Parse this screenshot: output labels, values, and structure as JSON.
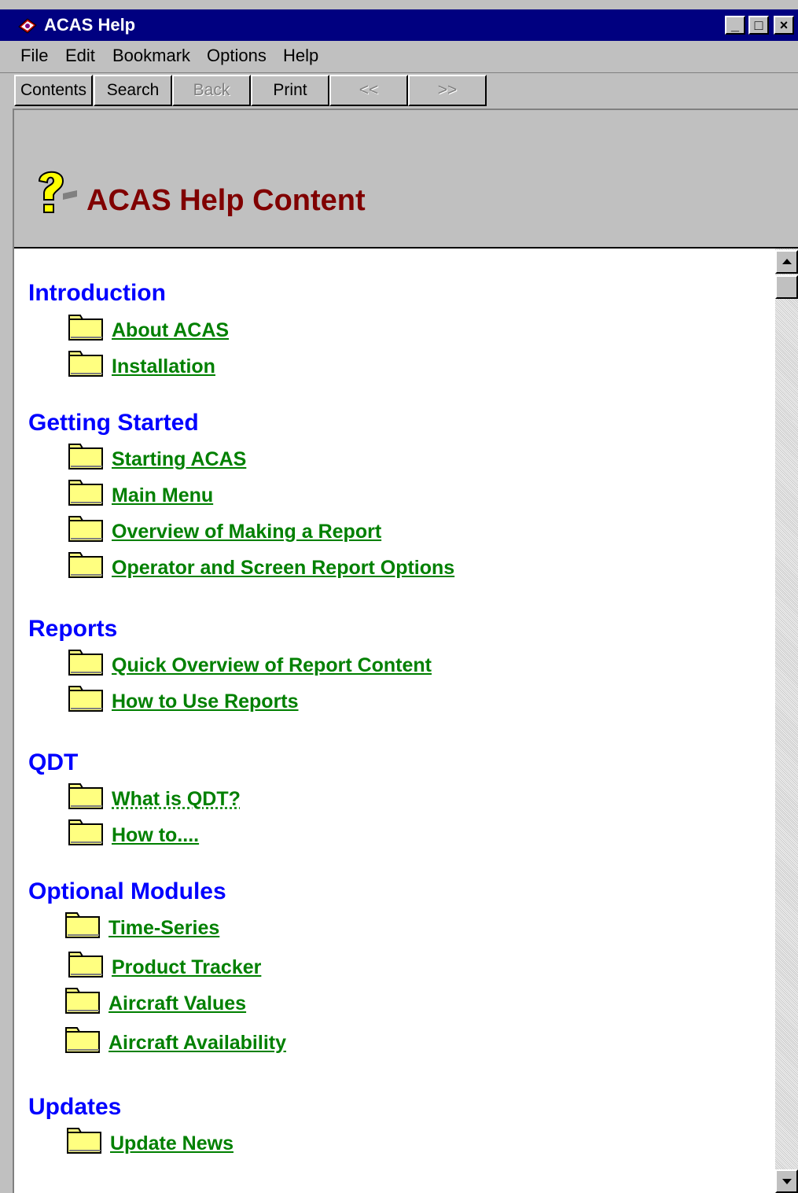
{
  "window": {
    "title": "ACAS Help",
    "controls": [
      "_",
      "□",
      "×"
    ]
  },
  "menu": [
    "File",
    "Edit",
    "Bookmark",
    "Options",
    "Help"
  ],
  "toolbar": {
    "contents": "Contents",
    "search": "Search",
    "back": "Back",
    "print": "Print",
    "prev": "<<",
    "next": ">>"
  },
  "header": {
    "title": "ACAS Help Content"
  },
  "sections": [
    {
      "title": "Introduction",
      "topics": [
        "About ACAS",
        "Installation"
      ]
    },
    {
      "title": "Getting Started",
      "topics": [
        "Starting ACAS",
        "Main Menu",
        "Overview of Making a Report",
        "Operator and Screen Report Options"
      ]
    },
    {
      "title": "Reports",
      "topics": [
        "Quick Overview of Report Content",
        "How to Use Reports"
      ]
    },
    {
      "title": "QDT",
      "topics": [
        "What is QDT?",
        "How to...."
      ]
    },
    {
      "title": "Optional Modules",
      "topics": [
        "Time-Series",
        "Product Tracker",
        "Aircraft Values",
        "Aircraft Availability"
      ]
    },
    {
      "title": "Updates",
      "topics": [
        "Update News"
      ]
    }
  ],
  "colors": {
    "titlebar": "#000080",
    "section": "#0000ff",
    "link": "#008000",
    "header_title": "#800000",
    "folder": "#ffff80"
  }
}
